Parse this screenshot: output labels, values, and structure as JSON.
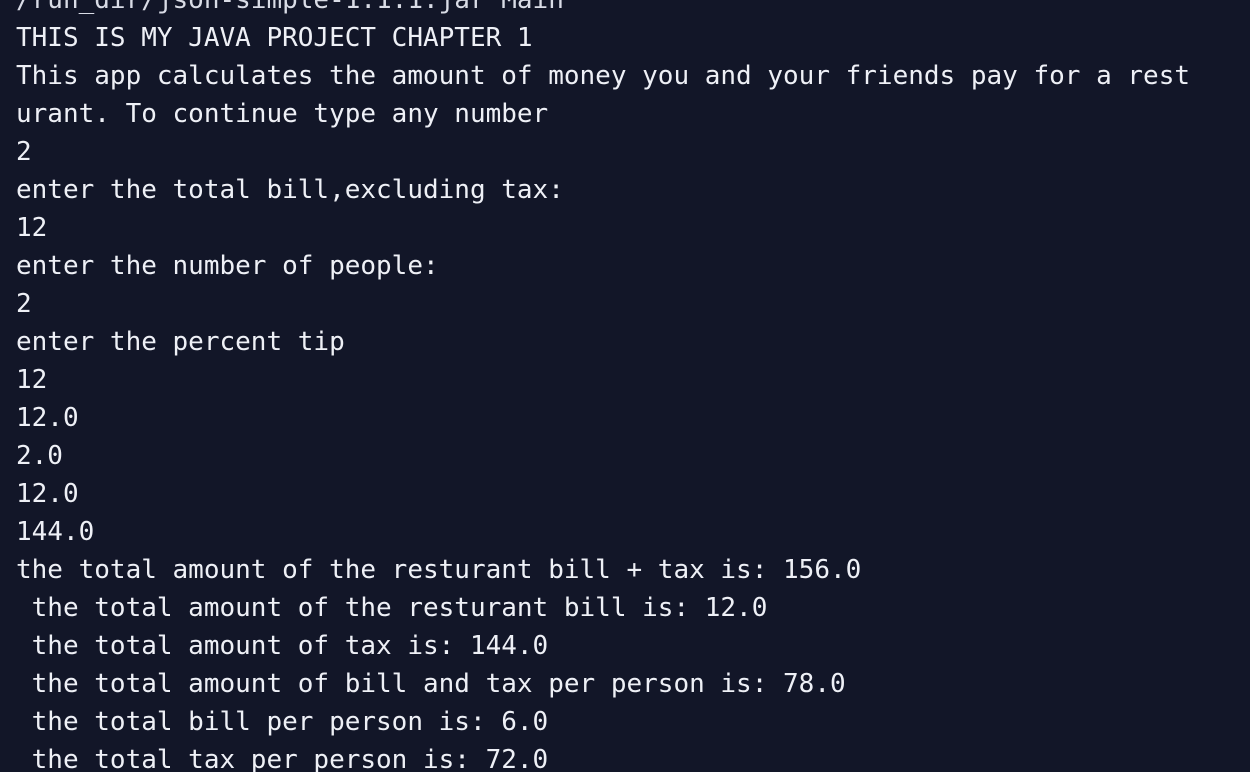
{
  "terminal": {
    "background": "#121628",
    "foreground": "#eef0f6",
    "cut_off_top_line": "/run_dir/json-simple-1.1.1.jar Main",
    "lines": [
      "THIS IS MY JAVA PROJECT CHAPTER 1",
      "This app calculates the amount of money you and your friends pay for a rest",
      "urant. To continue type any number",
      "2",
      "enter the total bill,excluding tax:",
      "12",
      "enter the number of people:",
      "2",
      "enter the percent tip",
      "12",
      "12.0",
      "2.0",
      "12.0",
      "144.0",
      "the total amount of the resturant bill + tax is: 156.0",
      " the total amount of the resturant bill is: 12.0",
      " the total amount of tax is: 144.0",
      " the total amount of bill and tax per person is: 78.0",
      " the total bill per person is: 6.0",
      " the total tax per person is: 72.0"
    ]
  }
}
